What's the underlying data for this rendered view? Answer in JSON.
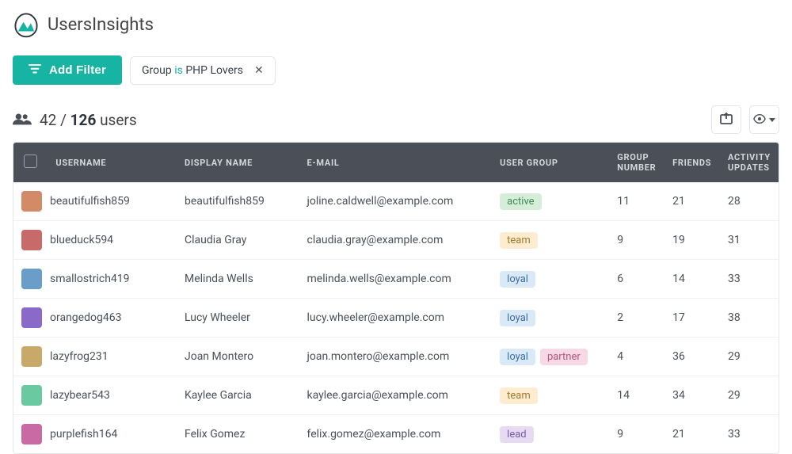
{
  "brand": {
    "name": "UsersInsights"
  },
  "toolbar": {
    "add_filter_label": "Add Filter",
    "chip": {
      "field": "Group",
      "op": "is",
      "value": "PHP Lovers"
    }
  },
  "count": {
    "visible": "42",
    "sep": "/",
    "total": "126",
    "suffix": "users"
  },
  "columns": {
    "username": "USERNAME",
    "display_name": "DISPLAY NAME",
    "email": "E-MAIL",
    "user_group": "USER GROUP",
    "group_number": "GROUP NUMBER",
    "friends": "FRIENDS",
    "activity_updates": "ACTIVITY UPDATES"
  },
  "tag_colors": {
    "active": "tag-active",
    "team": "tag-team",
    "loyal": "tag-loyal",
    "partner": "tag-partner",
    "lead": "tag-lead"
  },
  "avatar_colors": [
    "#d28b66",
    "#c96a6a",
    "#6a9ec9",
    "#8a6ac9",
    "#c9a96a",
    "#6ac9a0",
    "#c96aa5",
    "#6a6ac9"
  ],
  "rows": [
    {
      "username": "beautifulfish859",
      "display_name": "beautifulfish859",
      "email": "joline.caldwell@example.com",
      "groups": [
        "active"
      ],
      "group_number": "11",
      "friends": "21",
      "activity_updates": "28"
    },
    {
      "username": "blueduck594",
      "display_name": "Claudia Gray",
      "email": "claudia.gray@example.com",
      "groups": [
        "team"
      ],
      "group_number": "9",
      "friends": "19",
      "activity_updates": "31"
    },
    {
      "username": "smallostrich419",
      "display_name": "Melinda Wells",
      "email": "melinda.wells@example.com",
      "groups": [
        "loyal"
      ],
      "group_number": "6",
      "friends": "14",
      "activity_updates": "33"
    },
    {
      "username": "orangedog463",
      "display_name": "Lucy Wheeler",
      "email": "lucy.wheeler@example.com",
      "groups": [
        "loyal"
      ],
      "group_number": "2",
      "friends": "17",
      "activity_updates": "38"
    },
    {
      "username": "lazyfrog231",
      "display_name": "Joan Montero",
      "email": "joan.montero@example.com",
      "groups": [
        "loyal",
        "partner"
      ],
      "group_number": "4",
      "friends": "36",
      "activity_updates": "29"
    },
    {
      "username": "lazybear543",
      "display_name": "Kaylee Garcia",
      "email": "kaylee.garcia@example.com",
      "groups": [
        "team"
      ],
      "group_number": "14",
      "friends": "34",
      "activity_updates": "29"
    },
    {
      "username": "purplefish164",
      "display_name": "Felix Gomez",
      "email": "felix.gomez@example.com",
      "groups": [
        "lead"
      ],
      "group_number": "9",
      "friends": "21",
      "activity_updates": "33"
    }
  ]
}
